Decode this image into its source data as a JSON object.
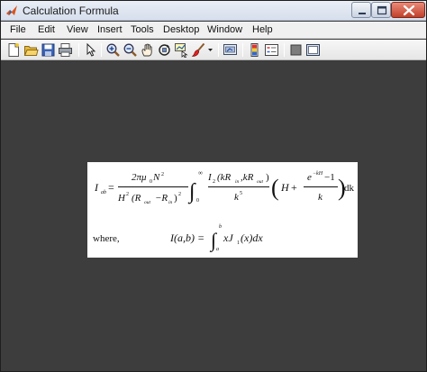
{
  "window": {
    "title": "Calculation Formula"
  },
  "menu": {
    "items": [
      "File",
      "Edit",
      "View",
      "Insert",
      "Tools",
      "Desktop",
      "Window",
      "Help"
    ]
  },
  "toolbar": {
    "icons": [
      "new-figure-icon",
      "open-file-icon",
      "save-icon",
      "print-icon",
      "edit-plot-arrow-icon",
      "zoom-in-icon",
      "zoom-out-icon",
      "pan-icon",
      "rotate-3d-icon",
      "data-cursor-icon",
      "brush-icon",
      "brush-dropdown-icon",
      "link-plot-icon",
      "insert-colorbar-icon",
      "insert-legend-icon",
      "hide-plot-tools-icon",
      "show-plot-tools-icon"
    ]
  },
  "formula": {
    "main_lhs": "I",
    "main_lhs_sub": "ab",
    "equals": "=",
    "coef_num": "2πμ",
    "coef_num_sub": "0",
    "coef_num_N": "N",
    "coef_num_pow": "2",
    "coef_den_h": "H",
    "coef_den_h_pow": "2",
    "coef_den_r": "(R",
    "coef_den_r_sub1": "out",
    "coef_den_minus": "−R",
    "coef_den_r_sub2": "in",
    "coef_den_close": ")",
    "coef_den_pow": "2",
    "int_sign": "∫",
    "int_upper": "∞",
    "int_lower": "0",
    "frac2_num_i": "I",
    "frac2_num_open": "2",
    "frac2_num_args": "(kR",
    "frac2_num_sub1": "in",
    "frac2_num_comma": ",kR",
    "frac2_num_sub2": "out",
    "frac2_num_close": ")",
    "frac2_den": "k",
    "frac2_den_pow": "5",
    "paren_open": "(",
    "paren_H": "H",
    "paren_plus": "+",
    "frac3_num": "e",
    "frac3_num_pow": "−kH",
    "frac3_num_minus": "−1",
    "frac3_den": "k",
    "paren_close": ")",
    "dk": "dk",
    "where_label": "where,",
    "def_lhs": "I(a,b) =",
    "def_int": "∫",
    "def_upper": "b",
    "def_lower": "a",
    "def_body": "xJ",
    "def_body_sub": "1",
    "def_tail": "(x)dx"
  }
}
